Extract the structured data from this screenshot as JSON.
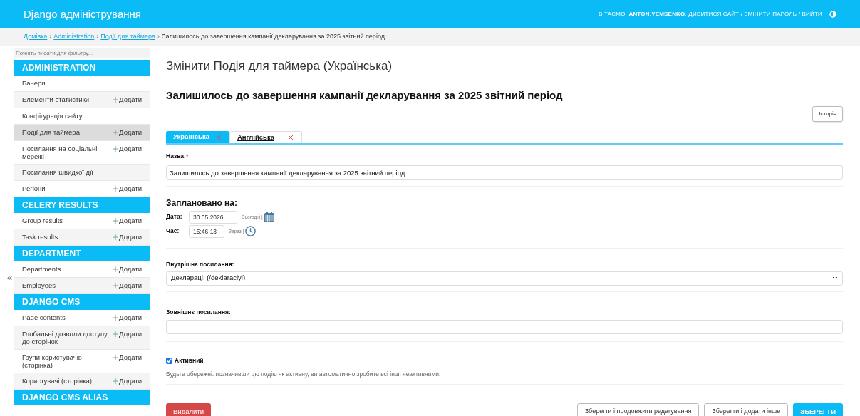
{
  "header": {
    "title": "Django адміністрування",
    "user_tools": [
      {
        "text": "ВІТАЄМО, ",
        "bold": false
      },
      {
        "text": "ANTON.YEMSENKO",
        "bold": true
      },
      {
        "text": ". ДИВИТИСЯ САЙТ / ЗМІНИТИ ПАРОЛЬ / ВИЙТИ",
        "bold": false
      }
    ]
  },
  "breadcrumbs": {
    "separator": "›",
    "links": [
      "Домівка",
      "Administration",
      "Події для таймера"
    ],
    "current": "Залишилось до завершення кампанії декларування за 2025 звітний період"
  },
  "sidebar": {
    "filter_placeholder": "Почніть писати для фільтру...",
    "collapse": "«",
    "sections": [
      {
        "title": "ADMINISTRATION",
        "items": [
          {
            "name": "Банери",
            "selected": false
          },
          {
            "name": "Елементи статистики",
            "add": "Додати",
            "selected": false
          },
          {
            "name": "Конфігурація сайту",
            "selected": false
          },
          {
            "name": "Події для таймера",
            "add": "Додати",
            "selected": true
          },
          {
            "name": "Посилання на соціальні мережі",
            "add": "Додати",
            "selected": false
          },
          {
            "name": "Посилання швидкої дії",
            "selected": false
          },
          {
            "name": "Регіони",
            "add": "Додати",
            "selected": false
          }
        ]
      },
      {
        "title": "CELERY RESULTS",
        "items": [
          {
            "name": "Group results",
            "add": "Додати",
            "selected": false
          },
          {
            "name": "Task results",
            "add": "Додати",
            "selected": false
          }
        ]
      },
      {
        "title": "DEPARTMENT",
        "items": [
          {
            "name": "Departments",
            "add": "Додати",
            "selected": false
          },
          {
            "name": "Employees",
            "add": "Додати",
            "selected": false
          }
        ]
      },
      {
        "title": "DJANGO CMS",
        "items": [
          {
            "name": "Page contents",
            "add": "Додати",
            "selected": false
          },
          {
            "name": "Глобальні дозволи доступу до сторінок",
            "add": "Додати",
            "selected": false
          },
          {
            "name": "Групи користувачів (сторінка)",
            "add": "Додати",
            "selected": false
          },
          {
            "name": "Користувачі (сторінка)",
            "add": "Додати",
            "selected": false
          }
        ]
      },
      {
        "title": "DJANGO CMS ALIAS"
      }
    ]
  },
  "main": {
    "page_title": "Змінити Подія для таймера (Українська)",
    "object_title": "Залишилось до завершення кампанії декларування за 2025 звітний період",
    "history_button": "Історія",
    "language_tabs": [
      {
        "label": "Українська",
        "selected": true
      },
      {
        "label": "Англійська",
        "selected": false
      }
    ],
    "name_field": {
      "label": "Назва:",
      "required": "*",
      "value": "Залишилось до завершення кампанії декларування за 2025 звітний період"
    },
    "schedule": {
      "heading": "Заплановано на:",
      "date_label": "Дата:",
      "date_value": "30.05.2026",
      "today_link": "Сьогодні |",
      "time_label": "Час:",
      "time_value": "15:46:13",
      "now_link": "Зараз |"
    },
    "internal_link": {
      "label": "Внутрішнє посилання:",
      "value": "Декларації (/deklaraciyi)"
    },
    "external_link": {
      "label": "Зовнішнє посилання:"
    },
    "active": {
      "label": "Активний",
      "checked": true,
      "help": "Будьте обережні: позначивши цю подію як активну, ви автоматично зробите всі інші неактивними."
    },
    "buttons": {
      "delete": "Видалити",
      "save_continue": "Зберегти і продовжити редагування",
      "save_add": "Зберегти і додати інше",
      "save": "ЗБЕРЕГТИ"
    }
  }
}
